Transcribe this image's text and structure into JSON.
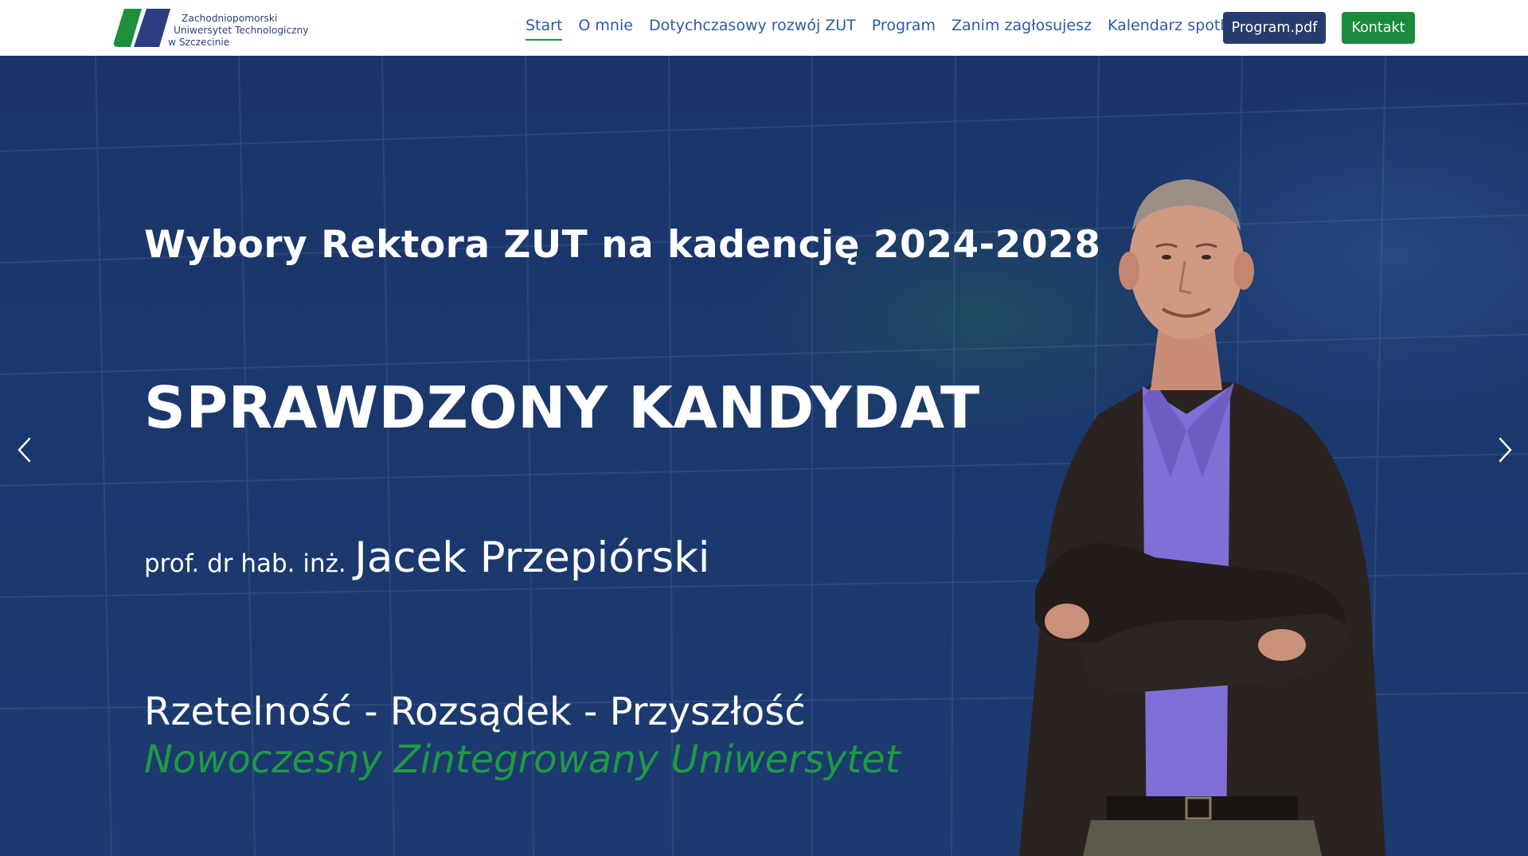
{
  "brand": {
    "line1": "Zachodniopomorski",
    "line2": "Uniwersytet Technologiczny",
    "line3": "w Szczecinie",
    "colors": {
      "green": "#1f8f3e",
      "blue": "#2c3e82"
    }
  },
  "nav": {
    "items": [
      {
        "label": "Start",
        "active": true
      },
      {
        "label": "O mnie"
      },
      {
        "label": "Dotychczasowy rozwój ZUT"
      },
      {
        "label": "Program"
      },
      {
        "label": "Zanim zagłosujesz"
      },
      {
        "label": "Kalendarz spotkań"
      }
    ],
    "pdf_button": "Program.pdf",
    "contact_button": "Kontakt"
  },
  "hero": {
    "subtitle": "Wybory Rektora ZUT na kadencję 2024-2028",
    "title": "SPRAWDZONY KANDYDAT",
    "degree": "prof. dr hab. inż.",
    "name": "Jacek Przepiórski",
    "motto": "Rzetelność - Rozsądek - Przyszłość",
    "tagline": "Nowoczesny Zintegrowany Uniwersytet",
    "background_color": "#1b376c",
    "tagline_color": "#1f9a45",
    "prev_icon": "chevron-left-icon",
    "next_icon": "chevron-right-icon"
  }
}
